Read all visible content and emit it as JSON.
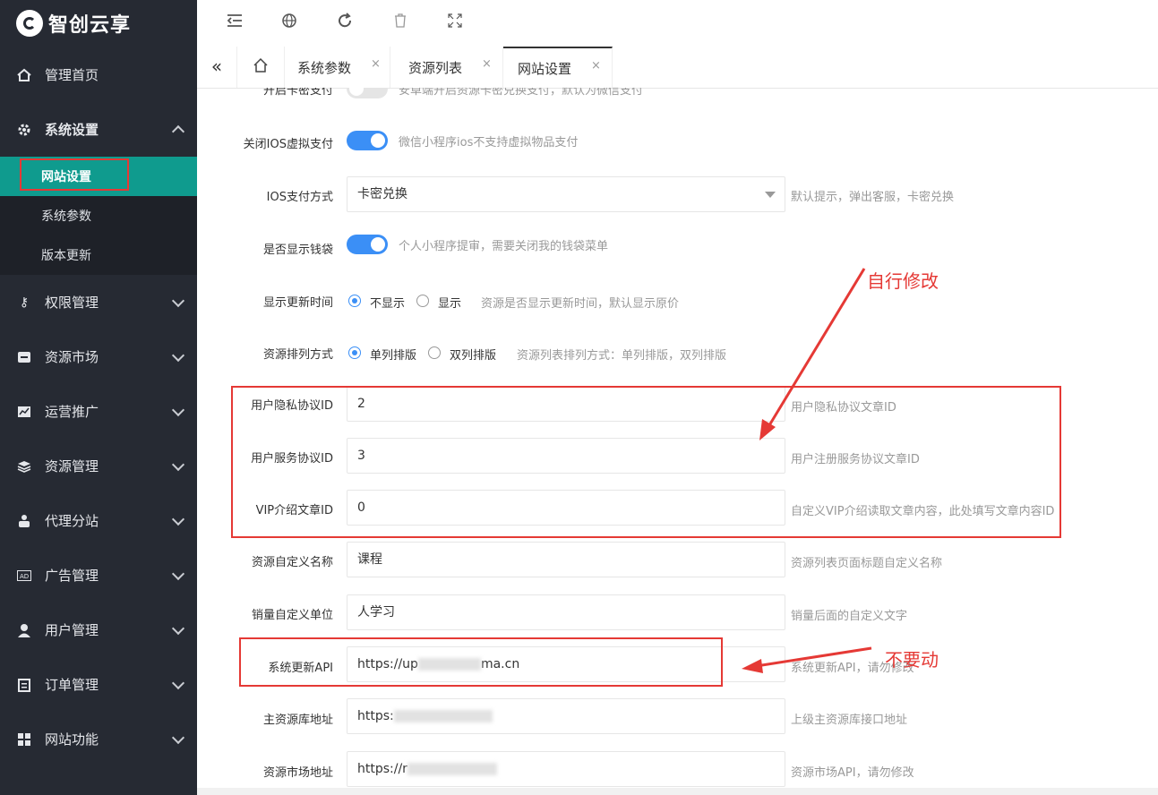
{
  "app": {
    "logo": "智创云享"
  },
  "sidebar": {
    "items": [
      {
        "label": "管理首页",
        "icon": "home-icon"
      },
      {
        "label": "系统设置",
        "icon": "gear-icon",
        "expanded": true,
        "children": [
          "网站设置",
          "系统参数",
          "版本更新"
        ]
      },
      {
        "label": "权限管理",
        "icon": "key-icon"
      },
      {
        "label": "资源市场",
        "icon": "store-icon"
      },
      {
        "label": "运营推广",
        "icon": "chart-icon"
      },
      {
        "label": "资源管理",
        "icon": "layers-icon"
      },
      {
        "label": "代理分站",
        "icon": "group-icon"
      },
      {
        "label": "广告管理",
        "icon": "ad-icon"
      },
      {
        "label": "用户管理",
        "icon": "user-icon"
      },
      {
        "label": "订单管理",
        "icon": "clipboard-icon"
      },
      {
        "label": "网站功能",
        "icon": "grid-icon"
      }
    ],
    "active": "网站设置"
  },
  "toolbar": {
    "icons": [
      "menu-fold-icon",
      "globe-icon",
      "refresh-icon",
      "trash-icon",
      "fullscreen-icon"
    ]
  },
  "tabs": {
    "collapse": "«",
    "home_icon": "home-icon",
    "items": [
      {
        "label": "系统参数",
        "close": "×"
      },
      {
        "label": "资源列表",
        "close": "×"
      },
      {
        "label": "网站设置",
        "close": "×",
        "active": true
      }
    ]
  },
  "form": {
    "card_pay": {
      "label": "开启卡密支付",
      "hint": "安卓端开启资源卡密兑换支付，默认为微信支付",
      "on": false
    },
    "close_ios": {
      "label": "关闭IOS虚拟支付",
      "hint": "微信小程序ios不支持虚拟物品支付",
      "on": true
    },
    "ios_pay": {
      "label": "IOS支付方式",
      "value": "卡密兑换",
      "hint": "默认提示，弹出客服，卡密兑换"
    },
    "wallet": {
      "label": "是否显示钱袋",
      "hint": "个人小程序提审，需要关闭我的钱袋菜单",
      "on": true
    },
    "update_time": {
      "label": "显示更新时间",
      "options": [
        "不显示",
        "显示"
      ],
      "selected": "不显示",
      "hint": "资源是否显示更新时间，默认显示原价"
    },
    "sort": {
      "label": "资源排列方式",
      "options": [
        "单列排版",
        "双列排版"
      ],
      "selected": "单列排版",
      "hint": "资源列表排列方式：单列排版，双列排版"
    },
    "privacy_id": {
      "label": "用户隐私协议ID",
      "value": "2",
      "hint": "用户隐私协议文章ID"
    },
    "service_id": {
      "label": "用户服务协议ID",
      "value": "3",
      "hint": "用户注册服务协议文章ID"
    },
    "vip_id": {
      "label": "VIP介绍文章ID",
      "value": "0",
      "hint": "自定义VIP介绍读取文章内容，此处填写文章内容ID"
    },
    "res_name": {
      "label": "资源自定义名称",
      "value": "课程",
      "hint": "资源列表页面标题自定义名称"
    },
    "sales_unit": {
      "label": "销量自定义单位",
      "value": "人学习",
      "hint": "销量后面的自定义文字"
    },
    "update_api": {
      "label": "系统更新API",
      "value_prefix": "https://up",
      "value_suffix": "ma.cn",
      "hint": "系统更新API，请勿修改"
    },
    "main_repo": {
      "label": "主资源库地址",
      "value_prefix": "https:",
      "hint": "上级主资源库接口地址"
    },
    "market": {
      "label": "资源市场地址",
      "value_prefix": "https://r",
      "hint": "资源市场API，请勿修改"
    }
  },
  "annotations": {
    "self_modify": "自行修改",
    "dont_touch": "不要动"
  },
  "colors": {
    "sidebar_bg": "#262a33",
    "active_green": "#0f9b8e",
    "switch_blue": "#3b8ff6",
    "annotation_red": "#e53935"
  }
}
